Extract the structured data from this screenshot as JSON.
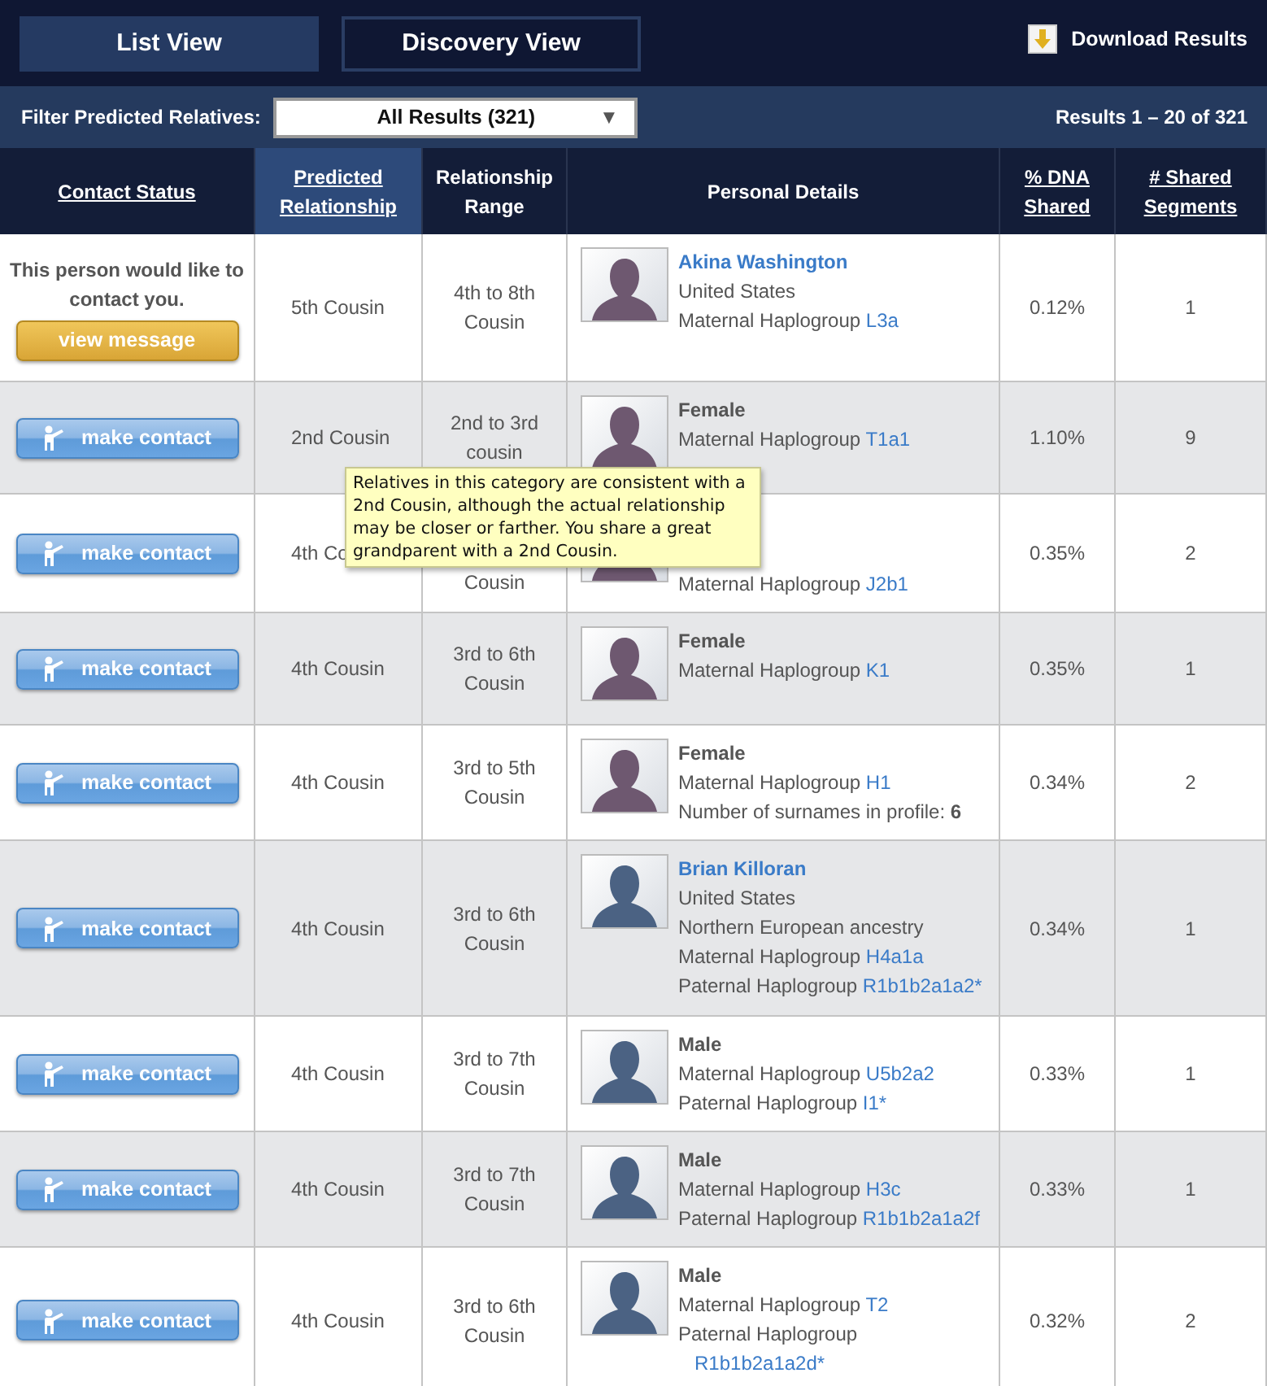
{
  "view_tabs": [
    {
      "label": "List View",
      "selected": true
    },
    {
      "label": "Discovery View",
      "selected": false
    }
  ],
  "download": {
    "label": "Download Results"
  },
  "filter": {
    "label": "Filter Predicted Relatives:",
    "value": "All Results (321)",
    "caret": "▼"
  },
  "results_count": "Results 1 – 20 of 321",
  "columns": [
    {
      "label": "Contact Status",
      "sortable": true,
      "selected": false
    },
    {
      "label": "Predicted Relationship",
      "sortable": true,
      "selected": true
    },
    {
      "label": "Relationship Range",
      "sortable": false,
      "selected": false
    },
    {
      "label": "Personal Details",
      "sortable": false,
      "selected": false
    },
    {
      "label": "% DNA Shared",
      "sortable": true,
      "selected": false
    },
    {
      "label": "# Shared Segments",
      "sortable": true,
      "selected": false
    }
  ],
  "rows": [
    {
      "status": {
        "kind": "message",
        "note": "This person would like to contact you.",
        "button": "view message"
      },
      "relationship": "5th Cousin",
      "range": "4th to 8th Cousin",
      "color": "#6e5870",
      "details": [
        {
          "kind": "name",
          "text": "Akina Washington"
        },
        {
          "kind": "plain",
          "text": "United States"
        },
        {
          "kind": "haplo",
          "text": "Maternal Haplogroup",
          "link": "L3a"
        }
      ],
      "dna": "0.12%",
      "segments": "1"
    },
    {
      "status": {
        "kind": "contact",
        "button": "make contact"
      },
      "relationship": "2nd Cousin",
      "range": "2nd to 3rd cousin",
      "color": "#6e5870",
      "details": [
        {
          "kind": "gender",
          "text": "Female"
        },
        {
          "kind": "haplo",
          "text": "Maternal Haplogroup",
          "link": "T1a1"
        }
      ],
      "dna": "1.10%",
      "segments": "9"
    },
    {
      "status": {
        "kind": "contact",
        "button": "make contact"
      },
      "relationship": "4th Co",
      "range": "Cousin",
      "covered_by_tooltip": true,
      "color": "#6e5870",
      "details": [
        {
          "kind": "haplo",
          "text": "Maternal Haplogroup",
          "link": "J2b1"
        }
      ],
      "dna": "0.35%",
      "segments": "2"
    },
    {
      "status": {
        "kind": "contact",
        "button": "make contact"
      },
      "relationship": "4th Cousin",
      "range": "3rd to 6th Cousin",
      "color": "#6e5870",
      "details": [
        {
          "kind": "gender",
          "text": "Female"
        },
        {
          "kind": "haplo",
          "text": "Maternal Haplogroup",
          "link": "K1"
        }
      ],
      "dna": "0.35%",
      "segments": "1"
    },
    {
      "status": {
        "kind": "contact",
        "button": "make contact"
      },
      "relationship": "4th Cousin",
      "range": "3rd to 5th Cousin",
      "color": "#6e5870",
      "details": [
        {
          "kind": "gender",
          "text": "Female"
        },
        {
          "kind": "haplo",
          "text": "Maternal Haplogroup",
          "link": "H1"
        },
        {
          "kind": "count",
          "text": "Number of surnames in profile:",
          "value": "6"
        }
      ],
      "dna": "0.34%",
      "segments": "2"
    },
    {
      "status": {
        "kind": "contact",
        "button": "make contact"
      },
      "relationship": "4th Cousin",
      "range": "3rd to 6th Cousin",
      "color": "#4b6283",
      "details": [
        {
          "kind": "name",
          "text": "Brian Killoran"
        },
        {
          "kind": "plain",
          "text": "United States"
        },
        {
          "kind": "plain",
          "text": "Northern European ancestry"
        },
        {
          "kind": "haplo",
          "text": "Maternal Haplogroup",
          "link": "H4a1a"
        },
        {
          "kind": "haplo",
          "text": "Paternal Haplogroup",
          "link": "R1b1b2a1a2*"
        }
      ],
      "dna": "0.34%",
      "segments": "1"
    },
    {
      "status": {
        "kind": "contact",
        "button": "make contact"
      },
      "relationship": "4th Cousin",
      "range": "3rd to 7th Cousin",
      "color": "#4b6283",
      "details": [
        {
          "kind": "gender",
          "text": "Male"
        },
        {
          "kind": "haplo",
          "text": "Maternal Haplogroup",
          "link": "U5b2a2"
        },
        {
          "kind": "haplo",
          "text": "Paternal Haplogroup",
          "link": "I1*"
        }
      ],
      "dna": "0.33%",
      "segments": "1"
    },
    {
      "status": {
        "kind": "contact",
        "button": "make contact"
      },
      "relationship": "4th Cousin",
      "range": "3rd to 7th Cousin",
      "color": "#4b6283",
      "details": [
        {
          "kind": "gender",
          "text": "Male"
        },
        {
          "kind": "haplo",
          "text": "Maternal Haplogroup",
          "link": "H3c"
        },
        {
          "kind": "haplo",
          "text": "Paternal Haplogroup",
          "link": "R1b1b2a1a2f"
        }
      ],
      "dna": "0.33%",
      "segments": "1"
    },
    {
      "status": {
        "kind": "contact",
        "button": "make contact"
      },
      "relationship": "4th Cousin",
      "range": "3rd to 6th Cousin",
      "color": "#4b6283",
      "details": [
        {
          "kind": "gender",
          "text": "Male"
        },
        {
          "kind": "haplo",
          "text": "Maternal Haplogroup",
          "link": "T2"
        },
        {
          "kind": "haplo_wrapped",
          "text": "Paternal Haplogroup",
          "link": "R1b1b2a1a2d*"
        }
      ],
      "dna": "0.32%",
      "segments": "2"
    }
  ],
  "tooltip": "Relatives in this category are consistent with a 2nd Cousin, although the actual relationship may be closer or farther.  You share a great grandparent with a 2nd Cousin."
}
